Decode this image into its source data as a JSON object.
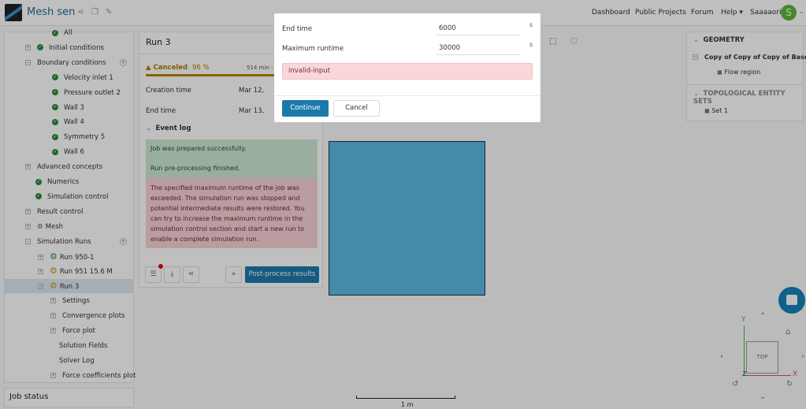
{
  "header": {
    "app_title": "Mesh sen",
    "nav": [
      "Dashboard",
      "Public Projects",
      "Forum",
      "Help ▾",
      "Saaaaori"
    ],
    "avatar_letter": "S"
  },
  "sidebar": {
    "items": [
      {
        "label": "All",
        "kind": "check"
      },
      {
        "label": "Initial conditions",
        "kind": "plus-check"
      },
      {
        "label": "Boundary conditions",
        "kind": "minus"
      },
      {
        "label": "Velocity inlet 1",
        "kind": "check"
      },
      {
        "label": "Pressure outlet 2",
        "kind": "check"
      },
      {
        "label": "Wall 3",
        "kind": "check"
      },
      {
        "label": "Wall 4",
        "kind": "check"
      },
      {
        "label": "Symmetry 5",
        "kind": "check"
      },
      {
        "label": "Wall 6",
        "kind": "check"
      },
      {
        "label": "Advanced concepts",
        "kind": "plus"
      },
      {
        "label": "Numerics",
        "kind": "check"
      },
      {
        "label": "Simulation control",
        "kind": "check"
      },
      {
        "label": "Result control",
        "kind": "plus"
      },
      {
        "label": "Mesh",
        "kind": "plus-mesh"
      },
      {
        "label": "Simulation Runs",
        "kind": "minus"
      },
      {
        "label": "Run 950-1",
        "kind": "run-ok"
      },
      {
        "label": "Run 951 15.6 M",
        "kind": "run-warn"
      },
      {
        "label": "Run 3",
        "kind": "run-warn-open"
      },
      {
        "label": "Settings",
        "kind": "plus"
      },
      {
        "label": "Convergence plots",
        "kind": "plus"
      },
      {
        "label": "Force plot",
        "kind": "plus"
      },
      {
        "label": "Solution Fields",
        "kind": "leaf"
      },
      {
        "label": "Solver Log",
        "kind": "leaf"
      },
      {
        "label": "Force coefficients plot",
        "kind": "plus"
      }
    ],
    "job_status": "Job status"
  },
  "run": {
    "title": "Run 3",
    "status": "Canceled",
    "percent": "96 %",
    "progress": 0.96,
    "duration": "514 min - 1",
    "creation_label": "Creation time",
    "creation_value": "Mar 12,",
    "end_label": "End time",
    "end_value": "Mar 13,",
    "event_log": "Event log",
    "log_green": [
      "Job was prepared successfully.",
      "Run pre-processing finished."
    ],
    "log_red": "The specified maximum runtime of the job was exceeded. The simulation run was stopped and potential intermediate results were restored. You can try to increase the maximum runtime in the simulation control section and start a new run to enable a complete simulation run.",
    "postprocess": "Post-process results"
  },
  "dialog": {
    "end_time_label": "End time",
    "end_time_value": "6000",
    "unit": "s",
    "max_runtime_label": "Maximum runtime",
    "max_runtime_value": "30000",
    "error": "invalid-input",
    "continue": "Continue",
    "cancel": "Cancel"
  },
  "right_panel": {
    "geometry": "GEOMETRY",
    "geometry_item": "Copy of Copy of Copy of Base_...",
    "region": "Flow region",
    "sets": "TOPOLOGICAL ENTITY SETS",
    "set": "Set 1"
  },
  "viewer": {
    "scale": "1 m",
    "cube_face": "TOP",
    "axis_x": "X",
    "axis_y": "Y",
    "axis_z": "Z"
  },
  "colors": {
    "accent": "#1b7aab",
    "warning": "#b98500",
    "success": "#2a8a3e"
  }
}
